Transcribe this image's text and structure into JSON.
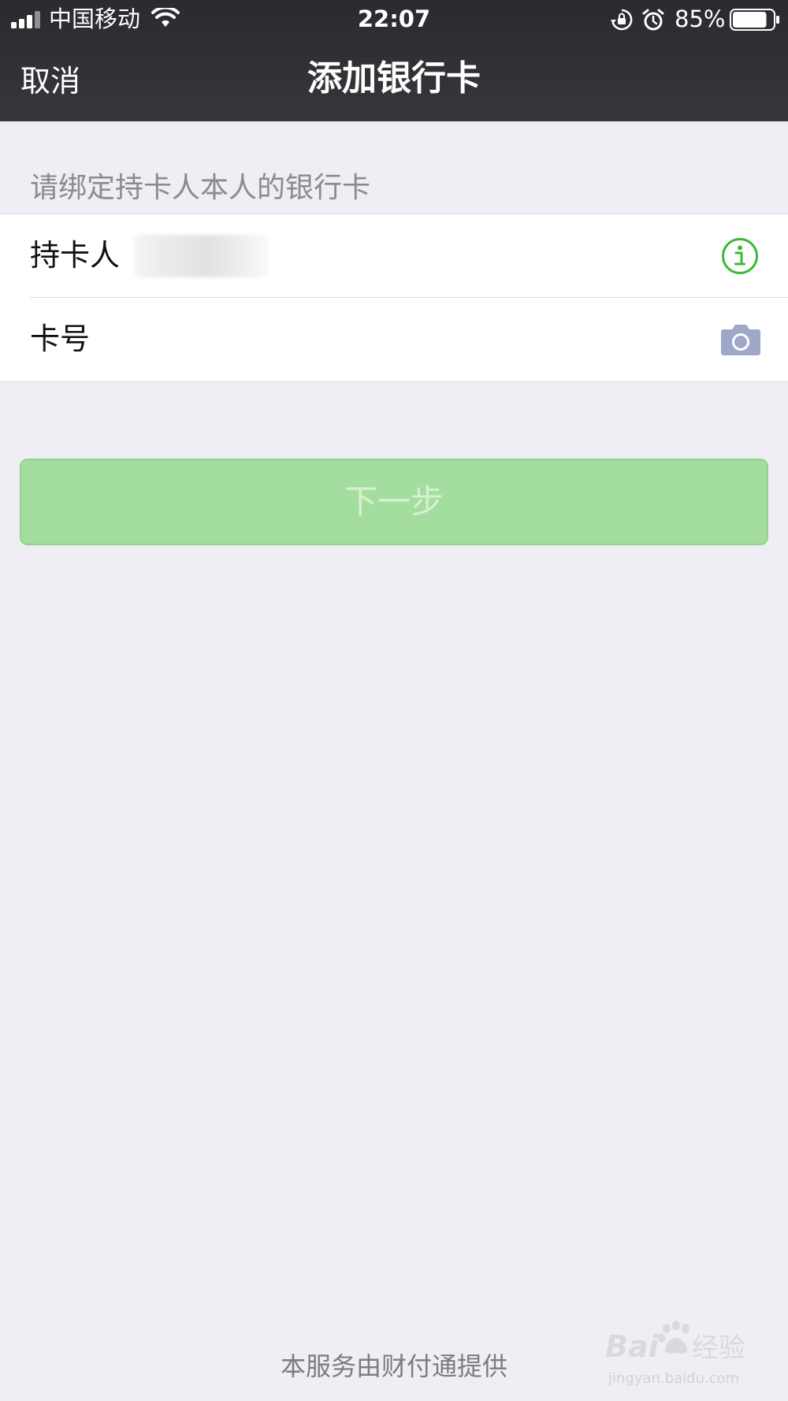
{
  "status_bar": {
    "carrier": "中国移动",
    "time": "22:07",
    "battery_percent": "85%",
    "battery_level": 0.85,
    "icons": [
      "signal-icon",
      "wifi-icon",
      "rotation-lock-icon",
      "alarm-icon",
      "battery-icon"
    ]
  },
  "nav": {
    "cancel_label": "取消",
    "title": "添加银行卡"
  },
  "form": {
    "section_hint": "请绑定持卡人本人的银行卡",
    "holder_label": "持卡人",
    "holder_info_icon": "info-icon",
    "card_number_label": "卡号",
    "card_number_value": "",
    "camera_icon": "camera-icon"
  },
  "actions": {
    "next_label": "下一步"
  },
  "footer": {
    "provider_note": "本服务由财付通提供"
  },
  "watermark": {
    "brand": "Baidu经验",
    "url": "jingyan.baidu.com"
  },
  "colors": {
    "nav_background": "#2f2f33",
    "page_background": "#efeef4",
    "accent_green": "#3dba36",
    "next_button_disabled": "#a4de9f",
    "camera_icon": "#9fa8c8"
  }
}
